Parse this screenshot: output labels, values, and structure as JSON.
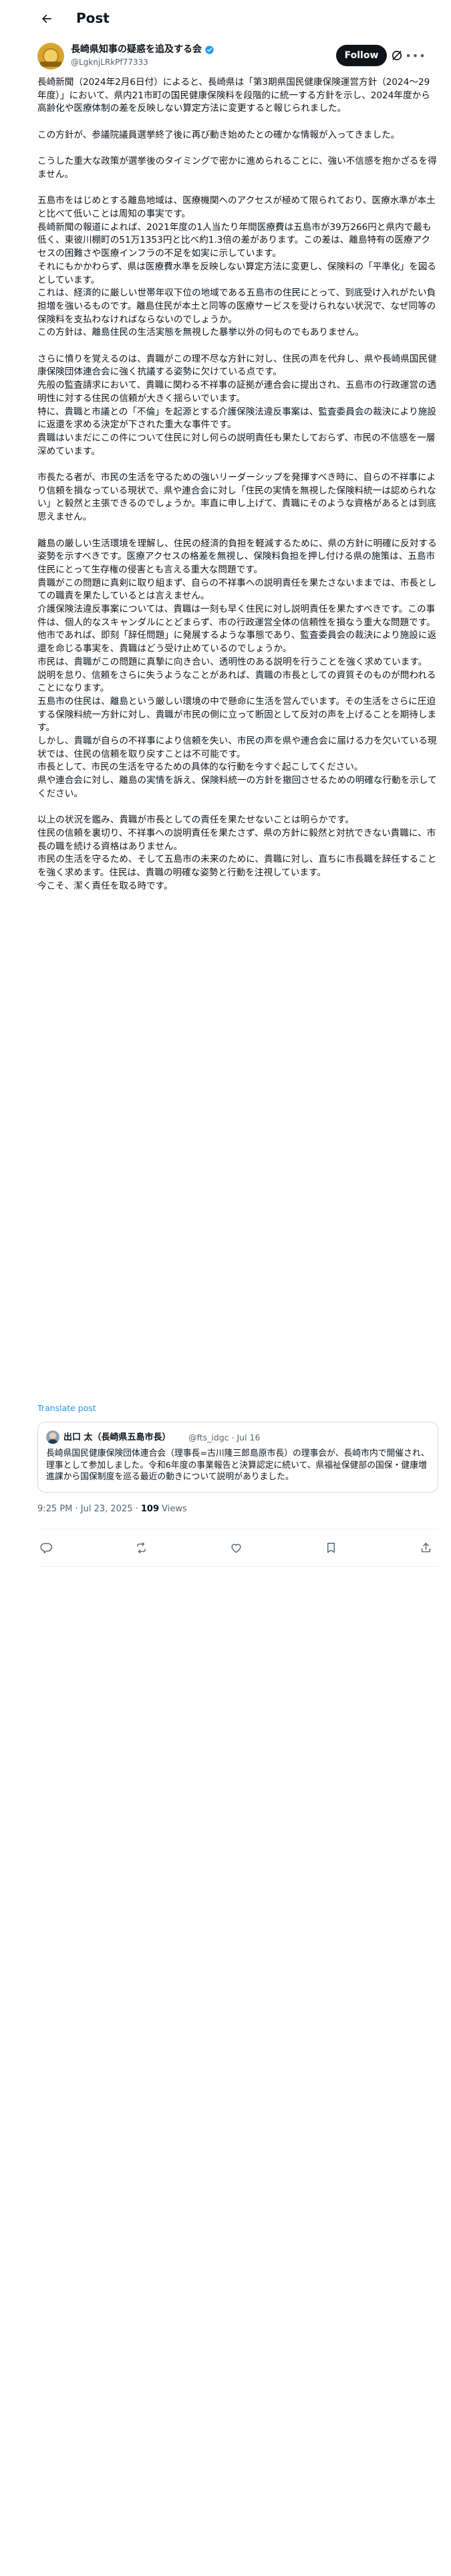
{
  "header": {
    "title": "Post"
  },
  "author": {
    "name": "長崎県知事の疑惑を追及する会",
    "handle": "@LgknjLRkPf77333",
    "follow_label": "Follow"
  },
  "post": {
    "paragraphs": [
      "長崎新聞（2024年2月6日付）によると、長崎県は「第3期県国民健康保険運営方針（2024〜29年度）」において、県内21市町の国民健康保険料を段階的に統一する方針を示し、2024年度から高齢化や医療体制の差を反映しない算定方法に変更すると報じられました。",
      "",
      "この方針が、参議院議員選挙終了後に再び動き始めたとの確かな情報が入ってきました。",
      "",
      "こうした重大な政策が選挙後のタイミングで密かに進められることに、強い不信感を抱かざるを得ません。",
      "",
      "五島市をはじめとする離島地域は、医療機関へのアクセスが極めて限られており、医療水準が本土と比べて低いことは周知の事実です。",
      "長崎新聞の報道によれば、2021年度の1人当たり年間医療費は五島市が39万266円と県内で最も低く、東彼川棚町の51万1353円と比べ約1.3倍の差があります。この差は、離島特有の医療アクセスの困難さや医療インフラの不足を如実に示しています。",
      "それにもかかわらず、県は医療費水準を反映しない算定方法に変更し、保険料の「平準化」を図るとしています。",
      "これは、経済的に厳しい世帯年収下位の地域である五島市の住民にとって、到底受け入れがたい負担増を強いるものです。離島住民が本土と同等の医療サービスを受けられない状況で、なぜ同等の保険料を支払わなければならないのでしょうか。",
      "この方針は、離島住民の生活実態を無視した暴挙以外の何ものでもありません。",
      "",
      "さらに憤りを覚えるのは、貴職がこの理不尽な方針に対し、住民の声を代弁し、県や長崎県国民健康保険団体連合会に強く抗議する姿勢に欠けている点です。",
      "先般の監査請求において、貴職に関わる不祥事の証拠が連合会に提出され、五島市の行政運営の透明性に対する住民の信頼が大きく揺らいでいます。",
      "特に、貴職と市議との「不倫」を起源とする介護保険法違反事案は、監査委員会の裁決により施設に返還を求める決定が下された重大な事件です。",
      "貴職はいまだにこの件について住民に対し何らの説明責任も果たしておらず、市民の不信感を一層深めています。",
      "",
      "市長たる者が、市民の生活を守るための強いリーダーシップを発揮すべき時に、自らの不祥事により信頼を損なっている現状で、県や連合会に対し「住民の実情を無視した保険料統一は認められない」と毅然と主張できるのでしょうか。率直に申し上げて、貴職にそのような資格があるとは到底思えません。",
      "",
      "離島の厳しい生活環境を理解し、住民の経済的負担を軽減するために、県の方針に明確に反対する姿勢を示すべきです。医療アクセスの格差を無視し、保険料負担を押し付ける県の施策は、五島市住民にとって生存権の侵害とも言える重大な問題です。",
      "貴職がこの問題に真剣に取り組まず、自らの不祥事への説明責任を果たさないままでは、市長としての職責を果たしているとは言えません。",
      "介護保険法違反事案については、貴職は一刻も早く住民に対し説明責任を果たすべきです。この事件は、個人的なスキャンダルにとどまらず、市の行政運営全体の信頼性を損なう重大な問題です。",
      "他市であれば、即刻「辞任問題」に発展するような事態であり、監査委員会の裁決により施設に返還を命じる事実を、貴職はどう受け止めているのでしょうか。",
      "市民は、貴職がこの問題に真摯に向き合い、透明性のある説明を行うことを強く求めています。",
      "説明を怠り、信頼をさらに失うようなことがあれば、貴職の市長としての資質そのものが問われることになります。",
      "五島市の住民は、離島という厳しい環境の中で懸命に生活を営んでいます。その生活をさらに圧迫する保険料統一方針に対し、貴職が市民の側に立って断固として反対の声を上げることを期待します。",
      "しかし、貴職が自らの不祥事により信頼を失い、市民の声を県や連合会に届ける力を欠いている現状では、住民の信頼を取り戻すことは不可能です。",
      "市長として、市民の生活を守るための具体的な行動を今すぐ起こしてください。",
      "県や連合会に対し、離島の実情を訴え、保険料統一の方針を撤回させるための明確な行動を示してください。",
      "",
      "以上の状況を鑑み、貴職が市長としての責任を果たせないことは明らかです。",
      "住民の信頼を裏切り、不祥事への説明責任を果たさず、県の方針に毅然と対抗できない貴職に、市長の職を続ける資格はありません。",
      "市民の生活を守るため、そして五島市の未来のために、貴職に対し、直ちに市長職を辞任することを強く求めます。住民は、貴職の明確な姿勢と行動を注視しています。",
      "今こそ、潔く責任を取る時です。"
    ],
    "translate_label": "Translate post",
    "timestamp": "9:25 PM · Jul 23, 2025 · ",
    "views_count": "109",
    "views_label": " Views"
  },
  "quote": {
    "author": "出口 太（長崎県五島市長）",
    "meta": "@fts_idgc · Jul 16",
    "text": "長崎県国民健康保険団体連合会（理事長=古川隆三郎島原市長）の理事会が、長崎市内で開催され、理事として参加しました。令和6年度の事業報告と決算認定に続いて、県福祉保健部の国保・健康増進課から国保制度を巡る最近の動きについて説明がありました。"
  },
  "icons": {
    "back": "arrow-left-icon",
    "verified": "verified-badge-icon",
    "grok": "grok-icon",
    "more": "more-icon",
    "reply": "reply-icon",
    "repost": "repost-icon",
    "like": "like-icon",
    "bookmark": "bookmark-icon",
    "share": "share-icon"
  },
  "colors": {
    "accent": "#1d9bf0",
    "text": "#0f1419",
    "muted": "#536471",
    "border": "#cfd9de"
  }
}
